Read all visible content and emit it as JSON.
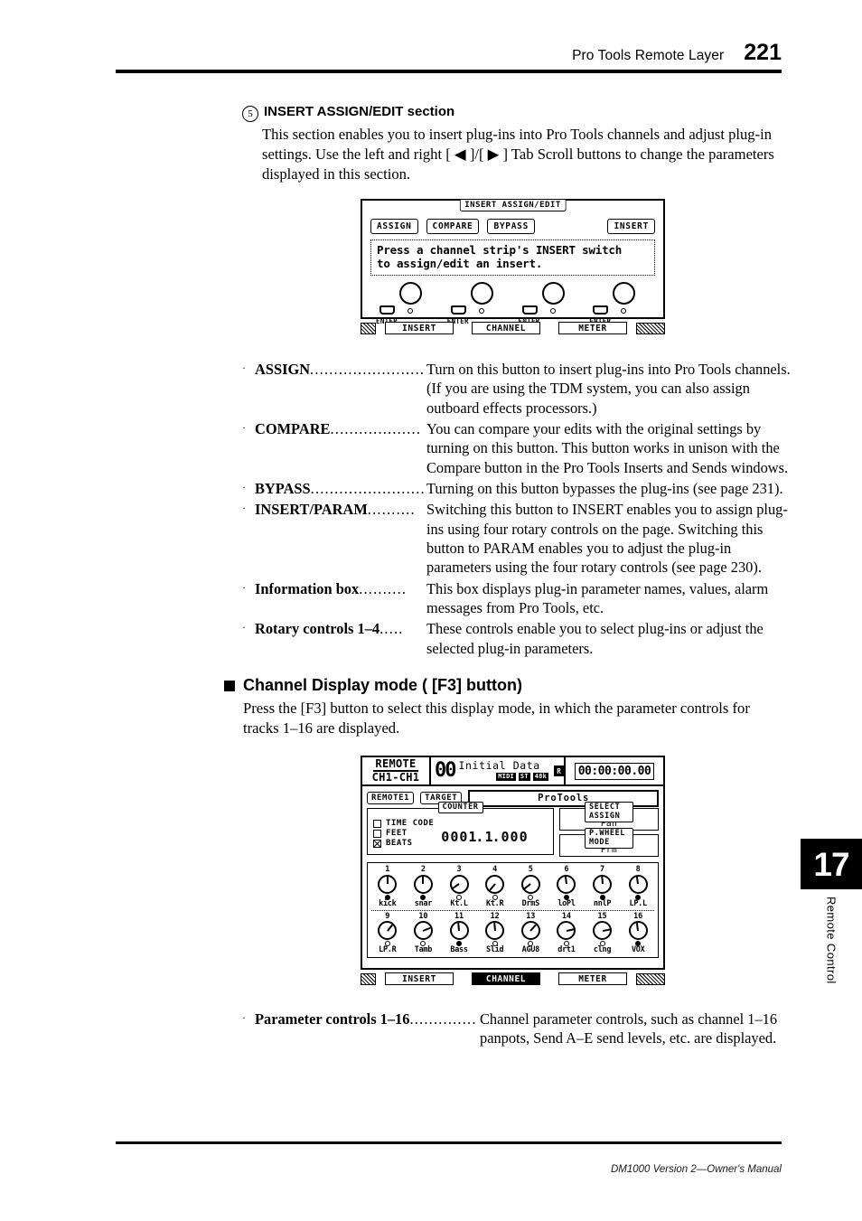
{
  "header": {
    "title": "Pro Tools Remote Layer",
    "page_number": "221"
  },
  "footer": {
    "text": "DM1000 Version 2—Owner's Manual"
  },
  "chapter_tab": {
    "number": "17",
    "label": "Remote Control"
  },
  "section5": {
    "marker": "5",
    "heading": "INSERT ASSIGN/EDIT section",
    "body": "This section enables you to insert plug-ins into Pro Tools channels and adjust plug-in settings. Use the left and right [ ◀ ]/[ ▶ ] Tab Scroll buttons to change the parameters displayed in this section."
  },
  "lcd_insert": {
    "title": "INSERT ASSIGN/EDIT",
    "buttons": [
      "ASSIGN",
      "COMPARE",
      "BYPASS"
    ],
    "insert_button": "INSERT",
    "info_line1": "Press a channel strip's INSERT switch",
    "info_line2": "to assign/edit an insert.",
    "enter_labels": [
      "ENTER",
      "ENTER",
      "ENTER",
      "ENTER"
    ],
    "tabs": [
      {
        "label": "INSERT",
        "active": true
      },
      {
        "label": "CHANNEL",
        "active": false
      },
      {
        "label": "METER",
        "active": false
      }
    ]
  },
  "definitions_insert": [
    {
      "term": "ASSIGN",
      "dots": "........................",
      "desc": "Turn on this button to insert plug-ins into Pro Tools channels. (If you are using the TDM system, you can also assign outboard effects processors.)"
    },
    {
      "term": "COMPARE",
      "dots": "...................",
      "desc": "You can compare your edits with the original settings by turning on this button. This button works in unison with the Compare button in the Pro Tools Inserts and Sends windows."
    },
    {
      "term": "BYPASS",
      "dots": "..........................",
      "desc": "Turning on this button bypasses the plug-ins (see page 231)."
    },
    {
      "term": "INSERT/PARAM",
      "dots": "..........",
      "desc": "Switching this button to INSERT enables you to assign plug-ins using four rotary controls on the page. Switching this button to PARAM enables you to adjust the plug-in parameters using the four rotary controls (see page 230)."
    },
    {
      "term": "Information box",
      "dots": "..........",
      "desc": "This box displays plug-in parameter names, values, alarm messages from Pro Tools, etc."
    },
    {
      "term": "Rotary controls 1–4",
      "dots": ".....",
      "desc": "These controls enable you to select plug-ins or adjust the selected plug-in parameters."
    }
  ],
  "channel_display": {
    "heading": "Channel Display mode ( [F3] button)",
    "body": "Press the [F3] button to select this display mode, in which the parameter controls for tracks 1–16 are displayed."
  },
  "lcd_channel": {
    "remote_line1": "REMOTE",
    "remote_line2": "CH1-CH1",
    "scene_number": "00",
    "scene_name": "Initial Data",
    "badge_lock": "R",
    "badges": [
      "MIDI",
      "ST",
      "48k"
    ],
    "timecode": "00:00:00.00",
    "remote_pill": "REMOTE1",
    "target_pill": "TARGET",
    "target_value": "ProTools",
    "counter_title": "COUNTER",
    "counter_options": [
      {
        "label": "TIME CODE",
        "checked": false
      },
      {
        "label": "FEET",
        "checked": false
      },
      {
        "label": "BEATS",
        "checked": true
      }
    ],
    "counter_digits": [
      "0",
      "0",
      "0",
      "1.",
      "1.",
      "0",
      "0",
      "0"
    ],
    "select_assign_title": "SELECT ASSIGN",
    "select_assign_value": "Pan",
    "pwheel_title": "P.WHEEL MODE",
    "pwheel_value": "Prm",
    "knobs_row1": [
      {
        "num": "1",
        "label": "kick",
        "angle": 0,
        "led": true
      },
      {
        "num": "2",
        "label": "snar",
        "angle": 0,
        "led": true
      },
      {
        "num": "3",
        "label": "Kt.L",
        "angle": -125,
        "led": false
      },
      {
        "num": "4",
        "label": "Kt.R",
        "angle": -140,
        "led": false
      },
      {
        "num": "5",
        "label": "DrmS",
        "angle": -130,
        "led": false
      },
      {
        "num": "6",
        "label": "loPl",
        "angle": -8,
        "led": true
      },
      {
        "num": "7",
        "label": "nnlP",
        "angle": -5,
        "led": true
      },
      {
        "num": "8",
        "label": "LP.L",
        "angle": -8,
        "led": true
      }
    ],
    "knobs_row2": [
      {
        "num": "9",
        "label": "LP.R",
        "angle": 38,
        "led": false
      },
      {
        "num": "10",
        "label": "Tamb",
        "angle": 68,
        "led": false
      },
      {
        "num": "11",
        "label": "Bass",
        "angle": -5,
        "led": true
      },
      {
        "num": "12",
        "label": "Slid",
        "angle": -5,
        "led": false
      },
      {
        "num": "13",
        "label": "AGU8",
        "angle": 42,
        "led": false
      },
      {
        "num": "14",
        "label": "drt1",
        "angle": 78,
        "led": false
      },
      {
        "num": "15",
        "label": "clng",
        "angle": 80,
        "led": false
      },
      {
        "num": "16",
        "label": "VOX",
        "angle": -7,
        "led": true
      }
    ],
    "tabs": [
      {
        "label": "INSERT",
        "active": false
      },
      {
        "label": "CHANNEL",
        "active": true
      },
      {
        "label": "METER",
        "active": false
      }
    ]
  },
  "definitions_channel": [
    {
      "term": "Parameter controls 1–16",
      "dots": "...................",
      "desc": "Channel parameter controls, such as channel 1–16 panpots, Send A–E send levels, etc. are displayed."
    }
  ]
}
